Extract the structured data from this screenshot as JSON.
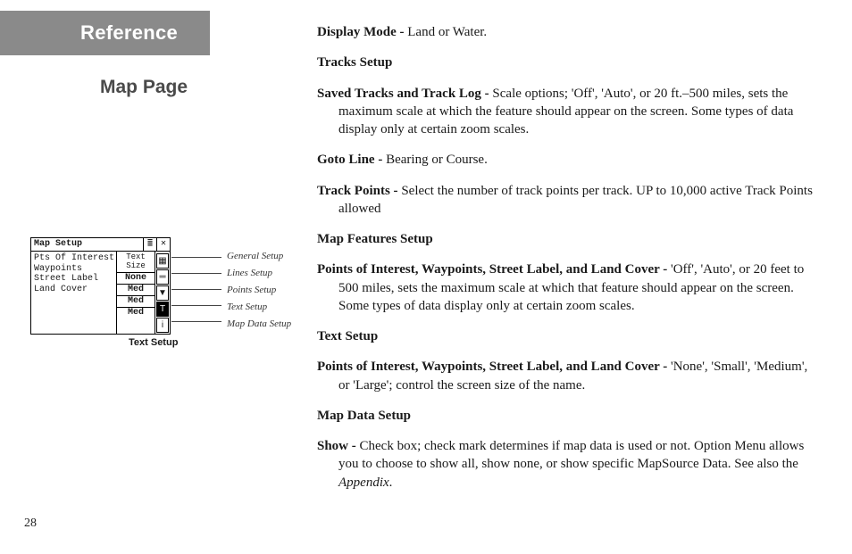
{
  "header": {
    "reference": "Reference",
    "subtitle": "Map Page"
  },
  "figure": {
    "panel_title": "Map Setup",
    "col_header": "Text Size",
    "rows": [
      {
        "label": "Pts Of Interest",
        "value": "None"
      },
      {
        "label": "Waypoints",
        "value": "Med"
      },
      {
        "label": "Street Label",
        "value": "Med"
      },
      {
        "label": "Land Cover",
        "value": "Med"
      }
    ],
    "callouts": [
      "General Setup",
      "Lines Setup",
      "Points Setup",
      "Text Setup",
      "Map Data Setup"
    ],
    "caption": "Text Setup",
    "titlebar_icons": {
      "menu": "≣",
      "close": "✕"
    },
    "side_icons": [
      "▦",
      "═",
      "▼",
      "T",
      "i"
    ]
  },
  "main": {
    "display_mode_label": "Display Mode - ",
    "display_mode_text": "Land or Water.",
    "tracks_setup_head": "Tracks Setup",
    "saved_tracks_label": "Saved Tracks and Track Log - ",
    "saved_tracks_text": "Scale options; 'Off', 'Auto', or 20 ft.–500 miles, sets the maximum scale at which the feature should appear on the screen.  Some types of data display only at certain zoom scales.",
    "goto_line_label": "Goto Line - ",
    "goto_line_text": "Bearing or Course.",
    "track_points_label": "Track Points - ",
    "track_points_text": "Select the number of track points per track.  UP to 10,000 active Track Points allowed",
    "map_features_head": "Map Features Setup",
    "poi_label": "Points of Interest, Waypoints, Street Label, and Land Cover - ",
    "poi_text": "'Off', 'Auto', or 20 feet to 500 miles, sets the maximum scale at which that feature should appear on the screen.  Some types of data display only at certain zoom scales.",
    "text_setup_head": "Text Setup",
    "text_setup_label": "Points of Interest, Waypoints, Street Label, and Land Cover - ",
    "text_setup_text": "'None', 'Small', 'Medium', or 'Large'; control the screen size of the name.",
    "map_data_head": "Map Data Setup",
    "show_label": "Show - ",
    "show_text_a": "Check box; check mark determines if map data is used or not.  Option Menu allows you to choose to show all, show none, or show specific MapSource Data.  See also the ",
    "show_text_b": "Appendix",
    "show_text_c": "."
  },
  "page_number": "28"
}
